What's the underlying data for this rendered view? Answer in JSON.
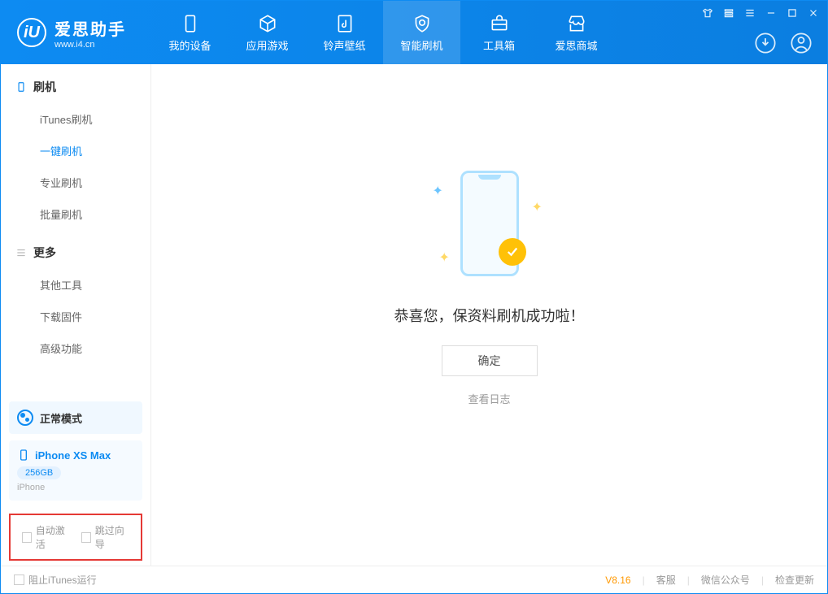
{
  "app": {
    "name": "爱思助手",
    "domain": "www.i4.cn"
  },
  "nav": {
    "tabs": [
      {
        "label": "我的设备"
      },
      {
        "label": "应用游戏"
      },
      {
        "label": "铃声壁纸"
      },
      {
        "label": "智能刷机"
      },
      {
        "label": "工具箱"
      },
      {
        "label": "爱思商城"
      }
    ]
  },
  "sidebar": {
    "group1": {
      "title": "刷机",
      "items": [
        "iTunes刷机",
        "一键刷机",
        "专业刷机",
        "批量刷机"
      ]
    },
    "group2": {
      "title": "更多",
      "items": [
        "其他工具",
        "下载固件",
        "高级功能"
      ]
    },
    "mode": "正常模式",
    "device": {
      "name": "iPhone XS Max",
      "storage": "256GB",
      "type": "iPhone"
    },
    "cb1": "自动激活",
    "cb2": "跳过向导"
  },
  "content": {
    "message": "恭喜您，保资料刷机成功啦！",
    "ok": "确定",
    "log": "查看日志"
  },
  "footer": {
    "block_itunes": "阻止iTunes运行",
    "version": "V8.16",
    "links": [
      "客服",
      "微信公众号",
      "检查更新"
    ]
  }
}
